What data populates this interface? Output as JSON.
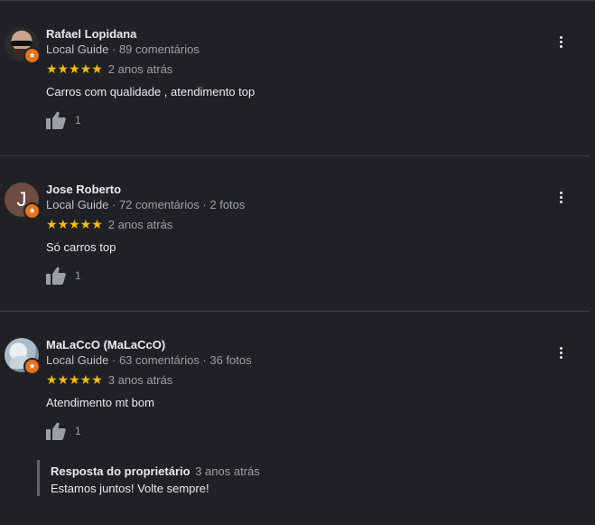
{
  "reviews": [
    {
      "name": "Rafael Lopidana",
      "guide_label": "Local Guide",
      "stats": " · 89 comentários",
      "stars": "★★★★★",
      "rating": 5,
      "time": "2 anos atrás",
      "text": "Carros com qualidade , atendimento top",
      "likes": "1",
      "avatar": "photo"
    },
    {
      "name": "Jose Roberto",
      "guide_label": "Local Guide",
      "stats": " · 72 comentários · 2 fotos",
      "stars": "★★★★★",
      "rating": 5,
      "time": "2 anos atrás",
      "text": "Só carros top",
      "likes": "1",
      "avatar_letter": "J",
      "avatar_color": "#6d4c41"
    },
    {
      "name": "MaLaCcO (MaLaCcO)",
      "guide_label": "Local Guide",
      "stats": " · 63 comentários · 36 fotos",
      "stars": "★★★★★",
      "rating": 5,
      "time": "3 anos atrás",
      "text": "Atendimento mt bom",
      "likes": "1",
      "avatar": "photo"
    }
  ],
  "owner_reply": {
    "label": "Resposta do proprietário",
    "time": "3 anos atrás",
    "text": "Estamos juntos! Volte sempre!"
  },
  "icons": {
    "badge": "local-guide-star-icon",
    "like": "thumbs-up-icon",
    "menu": "more-vert-icon"
  },
  "colors": {
    "background": "#202124",
    "star": "#fbbc04",
    "badge": "#e8711a",
    "text_primary": "#e8eaed",
    "text_secondary": "#9aa0a6"
  }
}
